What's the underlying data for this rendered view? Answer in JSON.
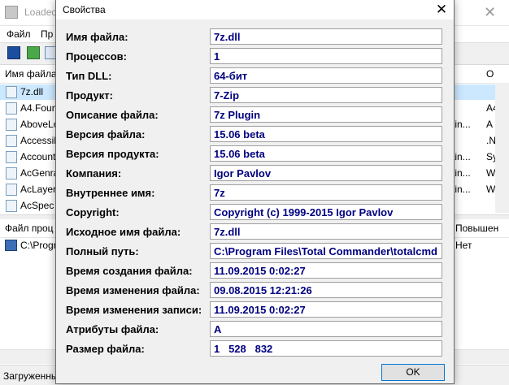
{
  "background_window": {
    "title": "Loaded",
    "menu": [
      "Файл",
      "Пр"
    ],
    "list_columns": [
      "Имя файла",
      "О"
    ],
    "list_rows": [
      {
        "name": "7z.dll",
        "tail": "",
        "tail2": ""
      },
      {
        "name": "A4.Foun",
        "tail": "",
        "tail2": "A4"
      },
      {
        "name": "AboveLo",
        "tail": "tin...",
        "tail2": "A"
      },
      {
        "name": "Accessib",
        "tail": "",
        "tail2": ".N"
      },
      {
        "name": "Account",
        "tail": "tin...",
        "tail2": "Sy"
      },
      {
        "name": "AcGenral",
        "tail": "tin...",
        "tail2": "W"
      },
      {
        "name": "AcLayers",
        "tail": "tin...",
        "tail2": "W"
      },
      {
        "name": "AcSpec",
        "tail": "",
        "tail2": ""
      }
    ],
    "lower_columns": [
      "Файл проц",
      "Повышен"
    ],
    "lower_row": {
      "name": "C:\\Progr",
      "tail": "Нет"
    },
    "status": "Загруженны"
  },
  "dialog": {
    "title": "Свойства",
    "close_glyph": "✕",
    "fields": [
      {
        "label": "Имя файла:",
        "value": "7z.dll"
      },
      {
        "label": "Процессов:",
        "value": "1"
      },
      {
        "label": "Тип DLL:",
        "value": "64-бит"
      },
      {
        "label": "Продукт:",
        "value": "7-Zip"
      },
      {
        "label": "Описание файла:",
        "value": "7z Plugin"
      },
      {
        "label": "Версия файла:",
        "value": "15.06 beta"
      },
      {
        "label": "Версия продукта:",
        "value": "15.06 beta"
      },
      {
        "label": "Компания:",
        "value": "Igor Pavlov"
      },
      {
        "label": "Внутреннее имя:",
        "value": "7z"
      },
      {
        "label": "Copyright:",
        "value": "Copyright (c) 1999-2015 Igor Pavlov"
      },
      {
        "label": "Исходное имя файла:",
        "value": "7z.dll"
      },
      {
        "label": "Полный путь:",
        "value": "C:\\Program Files\\Total Commander\\totalcmd"
      },
      {
        "label": "Время создания файла:",
        "value": "11.09.2015 0:02:27"
      },
      {
        "label": "Время изменения файла:",
        "value": "09.08.2015 12:21:26"
      },
      {
        "label": "Время изменения записи:",
        "value": "11.09.2015 0:02:27"
      },
      {
        "label": "Атрибуты файла:",
        "value": "A"
      },
      {
        "label": "Размер файла:",
        "value": "1   528   832"
      }
    ],
    "ok_label": "OK"
  },
  "colors": {
    "value_text": "#000080",
    "accent_border": "#0078d7"
  }
}
